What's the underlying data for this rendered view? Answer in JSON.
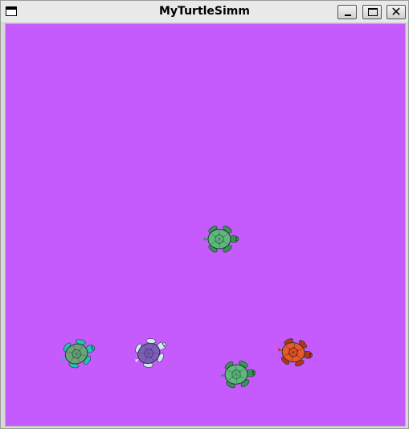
{
  "window": {
    "title": "MyTurtleSimm",
    "buttons": {
      "minimize_icon": "minimize-icon",
      "maximize_icon": "maximize-icon",
      "close_icon": "close-icon",
      "close_glyph": "✕"
    }
  },
  "canvas": {
    "background_color": "#c65bfd"
  },
  "turtles": [
    {
      "name": "turtle-center",
      "shell_color": "#5fb77f",
      "skin_color": "#3a8f5a",
      "pattern": "#2c6e45"
    },
    {
      "name": "turtle-bottom-left",
      "shell_color": "#6aa37a",
      "skin_color": "#21c2b7",
      "pattern": "#2f5f3d"
    },
    {
      "name": "turtle-purple",
      "shell_color": "#7d5fb7",
      "skin_color": "#d8e4ff",
      "pattern": "#4a3a7a"
    },
    {
      "name": "turtle-bottom-middle",
      "shell_color": "#5fb77f",
      "skin_color": "#3a8f5a",
      "pattern": "#2c6e45"
    },
    {
      "name": "turtle-red",
      "shell_color": "#e45a2a",
      "skin_color": "#b8321a",
      "pattern": "#6a1d0c"
    }
  ]
}
